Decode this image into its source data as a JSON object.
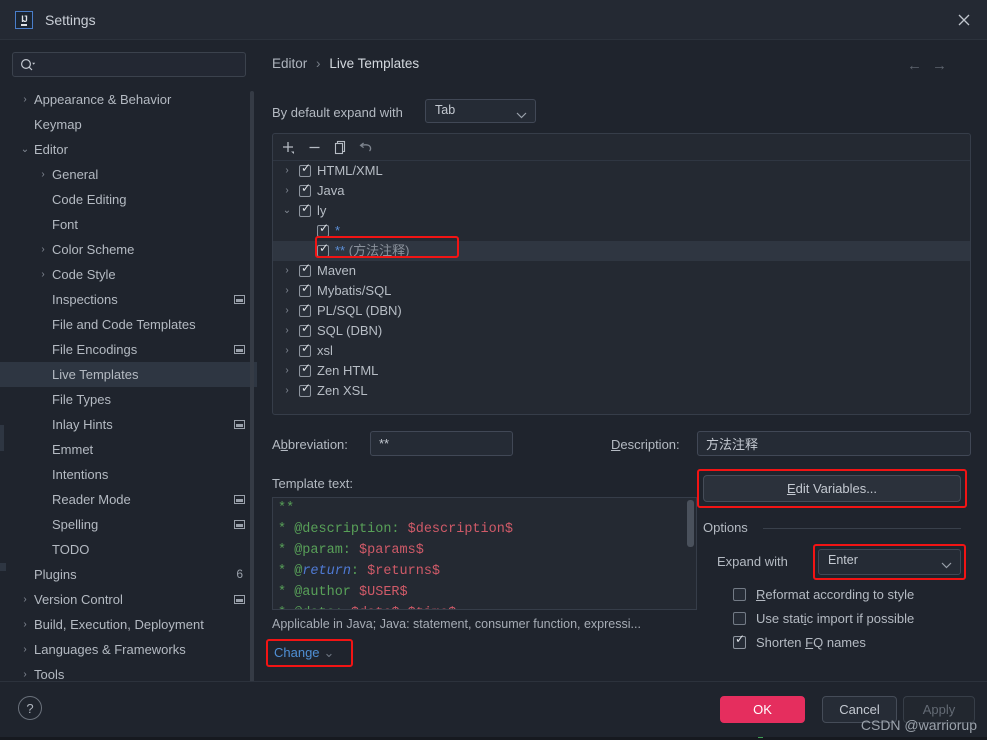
{
  "window": {
    "title": "Settings",
    "logo_text": "IJ",
    "close_icon": "close-icon"
  },
  "sidebar": {
    "search": {
      "value": "",
      "placeholder": ""
    },
    "items": [
      {
        "label": "Appearance & Behavior",
        "level": 0,
        "arrow": "›",
        "selected": false,
        "badge": "",
        "modified": false
      },
      {
        "label": "Keymap",
        "level": 0,
        "arrow": "",
        "selected": false,
        "badge": "",
        "modified": false
      },
      {
        "label": "Editor",
        "level": 0,
        "arrow": "⌄",
        "selected": false,
        "badge": "",
        "modified": false
      },
      {
        "label": "General",
        "level": 1,
        "arrow": "›",
        "selected": false,
        "badge": "",
        "modified": false
      },
      {
        "label": "Code Editing",
        "level": 1,
        "arrow": "",
        "selected": false,
        "badge": "",
        "modified": false
      },
      {
        "label": "Font",
        "level": 1,
        "arrow": "",
        "selected": false,
        "badge": "",
        "modified": false
      },
      {
        "label": "Color Scheme",
        "level": 1,
        "arrow": "›",
        "selected": false,
        "badge": "",
        "modified": false
      },
      {
        "label": "Code Style",
        "level": 1,
        "arrow": "›",
        "selected": false,
        "badge": "",
        "modified": false
      },
      {
        "label": "Inspections",
        "level": 1,
        "arrow": "",
        "selected": false,
        "badge": "",
        "modified": true
      },
      {
        "label": "File and Code Templates",
        "level": 1,
        "arrow": "",
        "selected": false,
        "badge": "",
        "modified": false
      },
      {
        "label": "File Encodings",
        "level": 1,
        "arrow": "",
        "selected": false,
        "badge": "",
        "modified": true
      },
      {
        "label": "Live Templates",
        "level": 1,
        "arrow": "",
        "selected": true,
        "badge": "",
        "modified": false
      },
      {
        "label": "File Types",
        "level": 1,
        "arrow": "",
        "selected": false,
        "badge": "",
        "modified": false
      },
      {
        "label": "Inlay Hints",
        "level": 1,
        "arrow": "",
        "selected": false,
        "badge": "",
        "modified": true
      },
      {
        "label": "Emmet",
        "level": 1,
        "arrow": "",
        "selected": false,
        "badge": "",
        "modified": false
      },
      {
        "label": "Intentions",
        "level": 1,
        "arrow": "",
        "selected": false,
        "badge": "",
        "modified": false
      },
      {
        "label": "Reader Mode",
        "level": 1,
        "arrow": "",
        "selected": false,
        "badge": "",
        "modified": true
      },
      {
        "label": "Spelling",
        "level": 1,
        "arrow": "",
        "selected": false,
        "badge": "",
        "modified": true
      },
      {
        "label": "TODO",
        "level": 1,
        "arrow": "",
        "selected": false,
        "badge": "",
        "modified": false
      },
      {
        "label": "Plugins",
        "level": 0,
        "arrow": "",
        "selected": false,
        "badge": "6",
        "modified": false
      },
      {
        "label": "Version Control",
        "level": 0,
        "arrow": "›",
        "selected": false,
        "badge": "",
        "modified": true
      },
      {
        "label": "Build, Execution, Deployment",
        "level": 0,
        "arrow": "›",
        "selected": false,
        "badge": "",
        "modified": false
      },
      {
        "label": "Languages & Frameworks",
        "level": 0,
        "arrow": "›",
        "selected": false,
        "badge": "",
        "modified": false
      },
      {
        "label": "Tools",
        "level": 0,
        "arrow": "›",
        "selected": false,
        "badge": "",
        "modified": false
      }
    ]
  },
  "main": {
    "breadcrumb": {
      "parent": "Editor",
      "separator": "›",
      "leaf": "Live Templates"
    },
    "default_expand": {
      "label": "By default expand with",
      "value": "Tab"
    },
    "toolbar": [
      {
        "name": "add-template-button",
        "icon": "plus-icon"
      },
      {
        "name": "remove-template-button",
        "icon": "minus-icon"
      },
      {
        "name": "duplicate-template-button",
        "icon": "copy-icon"
      },
      {
        "name": "revert-template-button",
        "icon": "undo-icon"
      }
    ],
    "templates": [
      {
        "label": "HTML/XML",
        "kind": "group",
        "arrow": "›",
        "checked": true,
        "selected": false
      },
      {
        "label": "Java",
        "kind": "group",
        "arrow": "›",
        "checked": true,
        "selected": false
      },
      {
        "label": "ly",
        "kind": "group",
        "arrow": "⌄",
        "checked": true,
        "selected": false
      },
      {
        "abbr": "*",
        "desc": "",
        "kind": "child",
        "checked": true,
        "selected": false
      },
      {
        "abbr": "**",
        "desc": "(方法注释)",
        "kind": "child",
        "checked": true,
        "selected": true
      },
      {
        "label": "Maven",
        "kind": "group",
        "arrow": "›",
        "checked": true,
        "selected": false
      },
      {
        "label": "Mybatis/SQL",
        "kind": "group",
        "arrow": "›",
        "checked": true,
        "selected": false
      },
      {
        "label": "PL/SQL (DBN)",
        "kind": "group",
        "arrow": "›",
        "checked": true,
        "selected": false
      },
      {
        "label": "SQL (DBN)",
        "kind": "group",
        "arrow": "›",
        "checked": true,
        "selected": false
      },
      {
        "label": "xsl",
        "kind": "group",
        "arrow": "›",
        "checked": true,
        "selected": false
      },
      {
        "label": "Zen HTML",
        "kind": "group",
        "arrow": "›",
        "checked": true,
        "selected": false
      },
      {
        "label": "Zen XSL",
        "kind": "group",
        "arrow": "›",
        "checked": true,
        "selected": false
      }
    ],
    "abbreviation": {
      "label": "Abbreviation:",
      "value": "**"
    },
    "description": {
      "label": "Description:",
      "value": "方法注释"
    },
    "template_text_label": "Template text:",
    "template_lines": [
      [
        {
          "t": "**",
          "c": "green"
        }
      ],
      [
        {
          "t": "* @description: ",
          "c": "green"
        },
        {
          "t": "$description$",
          "c": "pink"
        }
      ],
      [
        {
          "t": "* @param: ",
          "c": "green"
        },
        {
          "t": "$params$",
          "c": "pink"
        }
      ],
      [
        {
          "t": "* @",
          "c": "green"
        },
        {
          "t": "return",
          "c": "blue"
        },
        {
          "t": ": ",
          "c": "green"
        },
        {
          "t": "$returns$",
          "c": "pink"
        }
      ],
      [
        {
          "t": "* @author ",
          "c": "green"
        },
        {
          "t": "$USER$",
          "c": "pink"
        }
      ],
      [
        {
          "t": "* @date: ",
          "c": "green"
        },
        {
          "t": "$date$ $time$",
          "c": "pink"
        }
      ]
    ],
    "applicable_text": "Applicable in Java; Java: statement, consumer function, expressi...",
    "change_link": "Change",
    "edit_variables_button": "Edit Variables...",
    "options": {
      "title": "Options",
      "expand_with_label": "Expand with",
      "expand_with_value": "Enter",
      "checkboxes": [
        {
          "label": "Reformat according to style",
          "checked": false
        },
        {
          "label": "Use static import if possible",
          "checked": false
        },
        {
          "label": "Shorten FQ names",
          "checked": true
        }
      ]
    }
  },
  "footer": {
    "help_icon": "question-mark-icon",
    "ok": "OK",
    "cancel": "Cancel",
    "apply": "Apply",
    "watermark": "CSDN @warriorup"
  },
  "colors": {
    "dialog_bg": "#1f242d",
    "panel_bg": "#242932",
    "selection": "#2f3641",
    "accent_ok": "#e52e5e",
    "highlight_box": "#f21414",
    "link": "#4f8fd4"
  }
}
